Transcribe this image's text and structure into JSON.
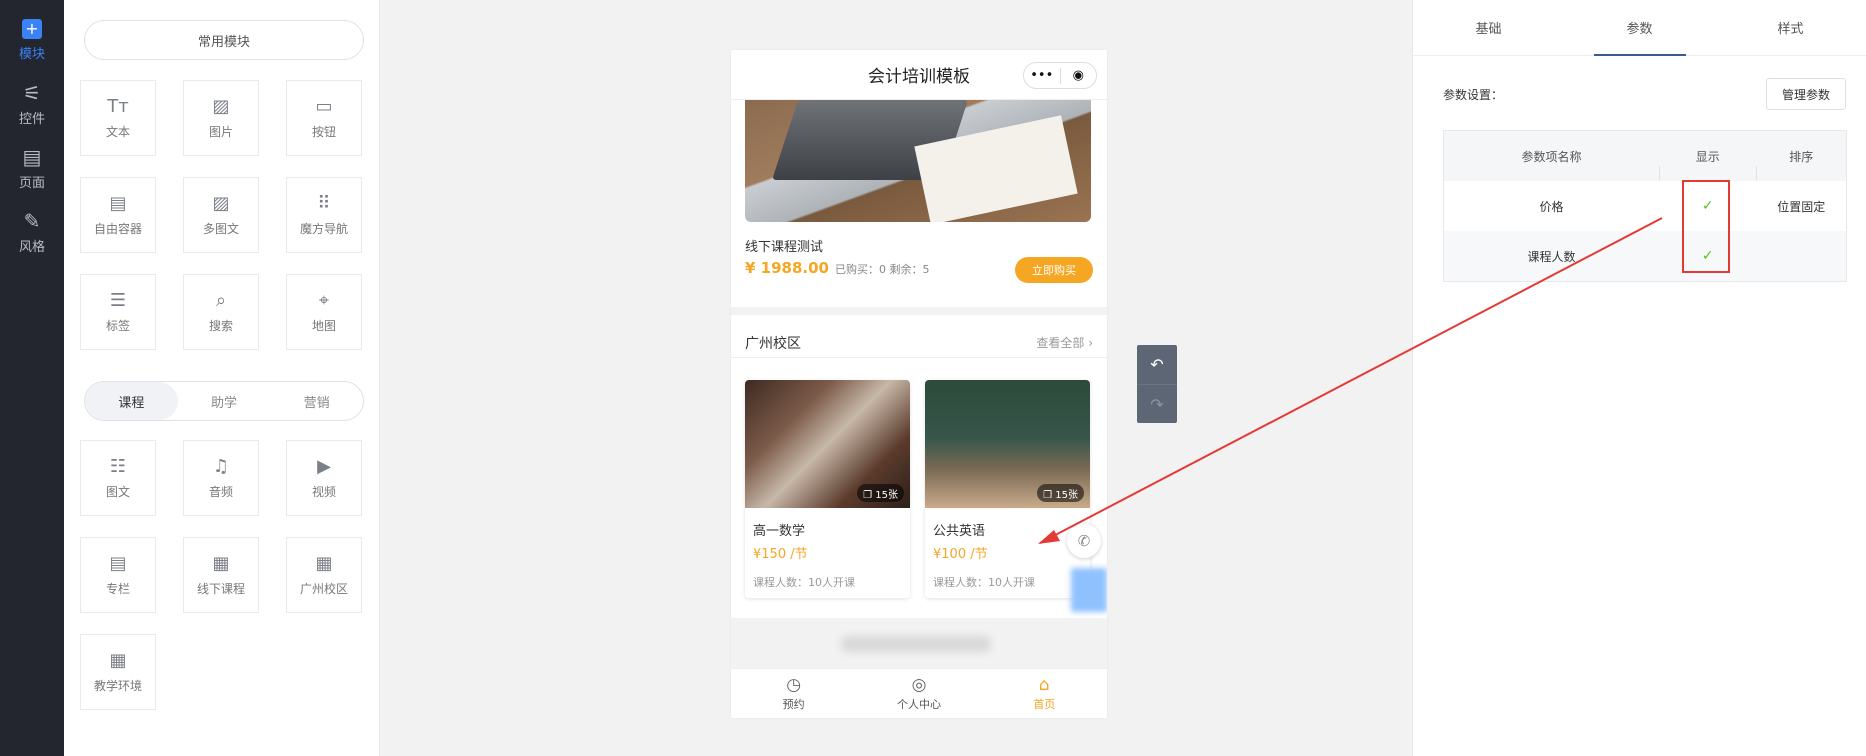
{
  "rail": {
    "items": [
      {
        "label": "模块",
        "icon": "plus-square-icon"
      },
      {
        "label": "控件",
        "icon": "sliders-icon"
      },
      {
        "label": "页面",
        "icon": "layout-icon"
      },
      {
        "label": "风格",
        "icon": "magic-wand-icon"
      }
    ]
  },
  "panel": {
    "common_title": "常用模块",
    "common": [
      {
        "label": "文本",
        "glyph": "Tт"
      },
      {
        "label": "图片",
        "glyph": "▨"
      },
      {
        "label": "按钮",
        "glyph": "▭"
      },
      {
        "label": "自由容器",
        "glyph": "▤"
      },
      {
        "label": "多图文",
        "glyph": "▨"
      },
      {
        "label": "魔方导航",
        "glyph": "⠿"
      },
      {
        "label": "标签",
        "glyph": "☰"
      },
      {
        "label": "搜索",
        "glyph": "⌕"
      },
      {
        "label": "地图",
        "glyph": "⌖"
      }
    ],
    "segments": [
      "课程",
      "助学",
      "营销"
    ],
    "course": [
      {
        "label": "图文",
        "glyph": "☷"
      },
      {
        "label": "音频",
        "glyph": "♫"
      },
      {
        "label": "视频",
        "glyph": "▶"
      },
      {
        "label": "专栏",
        "glyph": "▤"
      },
      {
        "label": "线下课程",
        "glyph": "▦"
      },
      {
        "label": "广州校区",
        "glyph": "▦"
      },
      {
        "label": "教学环境",
        "glyph": "▦"
      }
    ]
  },
  "phone": {
    "title": "会计培训模板",
    "capsule_more": "•••",
    "capsule_target": "◉",
    "course_title": "线下课程测试",
    "price": "¥ 1988.00",
    "meta": "已购买：0 剩余：5",
    "buy_label": "立即购买",
    "campus_title": "广州校区",
    "see_all": "查看全部 ›",
    "cards": [
      {
        "name": "高一数学",
        "price": "¥150 /节",
        "count": "课程人数：10人开课",
        "badge": "❐ 15张"
      },
      {
        "name": "公共英语",
        "price": "¥100 /节",
        "count": "课程人数：10人开课",
        "badge": "❐ 15张"
      }
    ],
    "tabs": [
      {
        "label": "预约",
        "glyph": "◷"
      },
      {
        "label": "个人中心",
        "glyph": "◎"
      },
      {
        "label": "首页",
        "glyph": "⌂"
      }
    ]
  },
  "right": {
    "tabs": [
      "基础",
      "参数",
      "样式"
    ],
    "param_label": "参数设置：",
    "manage_btn": "管理参数",
    "headers": [
      "参数项名称",
      "显示",
      "排序"
    ],
    "rows": [
      {
        "name": "价格",
        "show": "✓",
        "sort": "位置固定"
      },
      {
        "name": "课程人数",
        "show": "✓",
        "sort": ""
      }
    ]
  },
  "colors": {
    "accent": "#f5a623",
    "primary": "#3b82f6",
    "annotation": "#e53935"
  }
}
